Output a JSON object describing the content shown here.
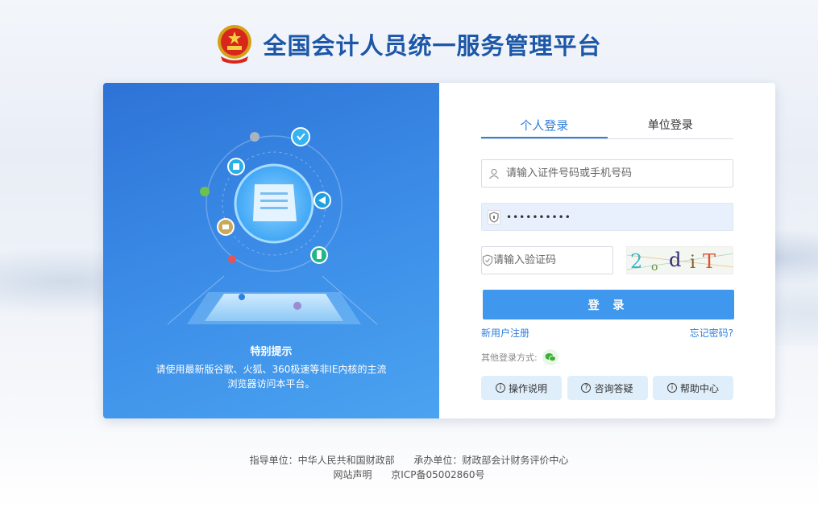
{
  "header": {
    "title": "全国会计人员统一服务管理平台"
  },
  "promo": {
    "title": "特别提示",
    "text": "请使用最新版谷歌、火狐、360极速等非IE内核的主流浏览器访问本平台。"
  },
  "login": {
    "tabs": [
      {
        "label": "个人登录",
        "active": true
      },
      {
        "label": "单位登录",
        "active": false
      }
    ],
    "id_placeholder": "请输入证件号码或手机号码",
    "password_value": "••••••••••",
    "captcha_placeholder": "请输入验证码",
    "captcha_text": "2 o d i T",
    "submit_label": "登 录",
    "register_link": "新用户注册",
    "forgot_link": "忘记密码?",
    "other_methods_label": "其他登录方式:",
    "help_buttons": [
      "操作说明",
      "咨询答疑",
      "帮助中心"
    ]
  },
  "footer": {
    "guide": "指导单位：中华人民共和国财政部",
    "organizer": "承办单位：财政部会计财务评价中心",
    "statement": "网站声明",
    "icp": "京ICP备05002860号"
  },
  "colors": {
    "accent": "#2f7fde",
    "button": "#3f97ee",
    "title": "#1c57a8",
    "promo_bg": "#3a8ae6"
  }
}
